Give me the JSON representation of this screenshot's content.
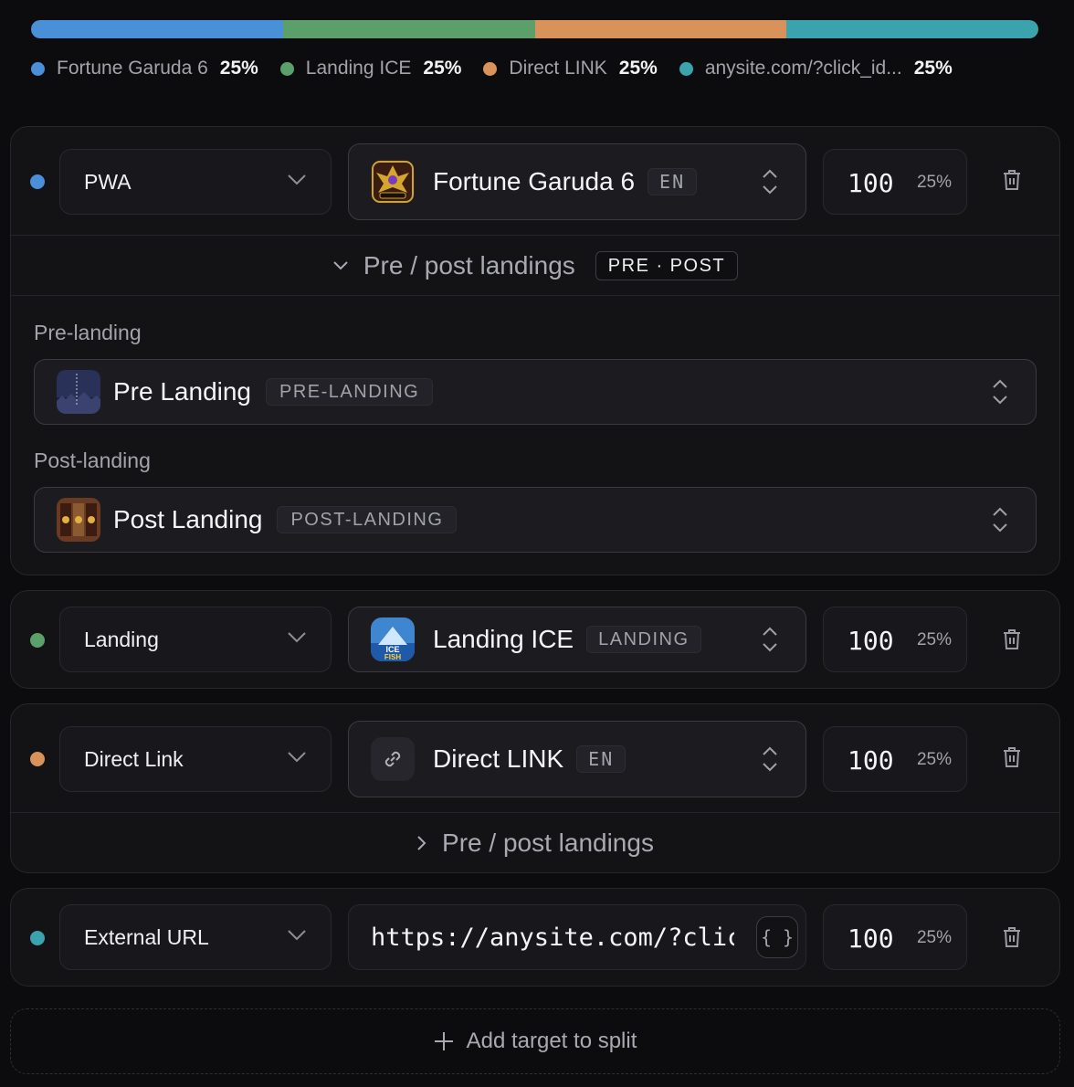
{
  "split_bar": [
    {
      "color": "#4a90d9",
      "share": 25
    },
    {
      "color": "#5ba06a",
      "share": 25
    },
    {
      "color": "#d9925a",
      "share": 25
    },
    {
      "color": "#3aa3ad",
      "share": 25
    }
  ],
  "legend": [
    {
      "name": "Fortune Garuda 6",
      "pct": "25%",
      "color": "#4a90d9"
    },
    {
      "name": "Landing ICE",
      "pct": "25%",
      "color": "#5ba06a"
    },
    {
      "name": "Direct LINK",
      "pct": "25%",
      "color": "#d9925a"
    },
    {
      "name": "anysite.com/?click_id...",
      "pct": "25%",
      "color": "#3aa3ad"
    }
  ],
  "targets": [
    {
      "color": "#4a90d9",
      "type": "PWA",
      "name": "Fortune Garuda 6",
      "tag": "EN",
      "weight": "100",
      "pct": "25%",
      "thumb_icon": "garuda-game-icon"
    },
    {
      "color": "#5ba06a",
      "type": "Landing",
      "name": "Landing ICE",
      "tag": "LANDING",
      "weight": "100",
      "pct": "25%",
      "thumb_icon": "ice-fish-game-icon"
    },
    {
      "color": "#d9925a",
      "type": "Direct Link",
      "name": "Direct LINK",
      "tag": "EN",
      "weight": "100",
      "pct": "25%",
      "thumb_icon": "link-icon"
    },
    {
      "color": "#3aa3ad",
      "type": "External URL",
      "url": "https://anysite.com/?click_id=",
      "url_braces": "{ }",
      "weight": "100",
      "pct": "25%"
    }
  ],
  "pre_post": {
    "expander_label": "Pre / post landings",
    "badge": "PRE · POST",
    "pre_label": "Pre-landing",
    "pre_name": "Pre Landing",
    "pre_tag": "PRE-LANDING",
    "post_label": "Post-landing",
    "post_name": "Post Landing",
    "post_tag": "POST-LANDING"
  },
  "direct_link_expander": "Pre / post landings",
  "add_target_label": "Add target to split"
}
